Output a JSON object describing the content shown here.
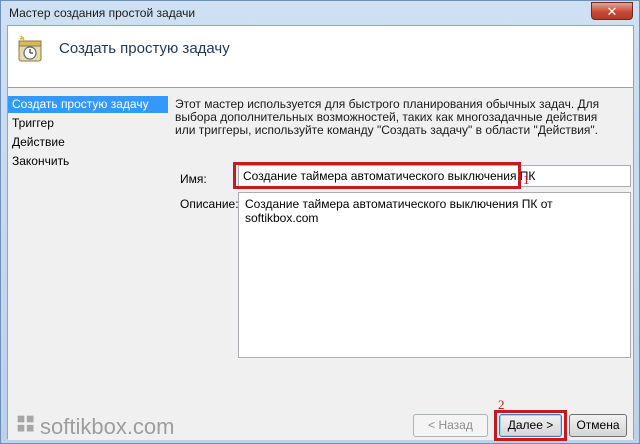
{
  "window": {
    "title": "Мастер создания простой задачи",
    "close_glyph": "✕",
    "close_color": "#c74a36"
  },
  "header": {
    "icon": "task-scheduler-clock-icon",
    "title": "Создать простую задачу"
  },
  "sidebar": {
    "items": [
      {
        "label": "Создать простую задачу",
        "active": true
      },
      {
        "label": "Триггер",
        "active": false
      },
      {
        "label": "Действие",
        "active": false
      },
      {
        "label": "Закончить",
        "active": false
      }
    ],
    "active_color": "#3399ff"
  },
  "main": {
    "description": "Этот мастер используется для быстрого планирования обычных задач.  Для выбора дополнительных возможностей, таких как многозадачные действия или триггеры, используйте команду \"Создать задачу\" в области \"Действия\".",
    "name_label": "Имя:",
    "name_value": "Создание таймера автоматического выключения ПК",
    "desc_label": "Описание:",
    "desc_value": "Создание таймера автоматического выключения ПК от softikbox.com"
  },
  "footer": {
    "back_label": "< Назад",
    "next_label": "Далее >",
    "cancel_label": "Отмена"
  },
  "annotations": {
    "step1": "1",
    "step2": "2",
    "color": "#c8191c"
  },
  "watermark": {
    "text": "softikbox.com",
    "icon": "softikbox-logo-icon"
  }
}
